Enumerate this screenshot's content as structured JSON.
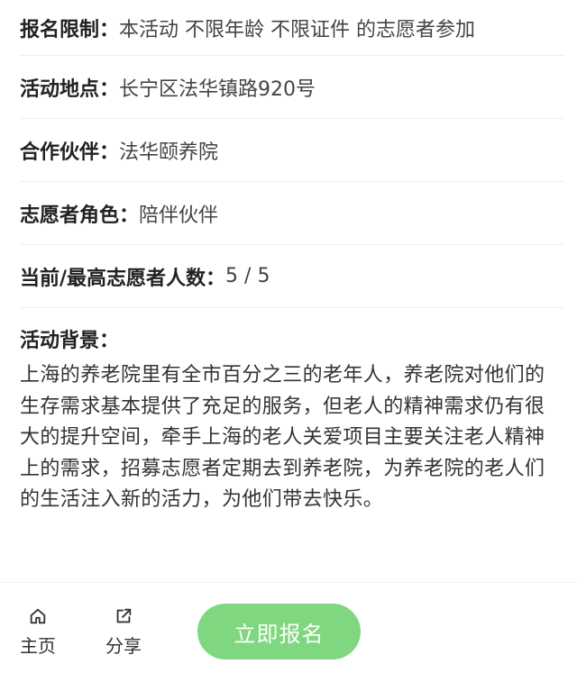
{
  "details": [
    {
      "label": "报名限制：",
      "value": "本活动 不限年龄 不限证件 的志愿者参加"
    },
    {
      "label": "活动地点：",
      "value": "长宁区法华镇路920号"
    },
    {
      "label": "合作伙伴：",
      "value": "法华颐养院"
    },
    {
      "label": "志愿者角色：",
      "value": "陪伴伙伴"
    },
    {
      "label": "当前/最高志愿者人数：",
      "value": "5 / 5"
    }
  ],
  "background": {
    "title": "活动背景：",
    "text": "上海的养老院里有全市百分之三的老年人，养老院对他们的生存需求基本提供了充足的服务，但老人的精神需求仍有很大的提升空间，牵手上海的老人关爱项目主要关注老人精神上的需求，招募志愿者定期去到养老院，为养老院的老人们的生活注入新的活力，为他们带去快乐。"
  },
  "tabbar": {
    "home_label": "主页",
    "home_icon": "home-icon",
    "share_label": "分享",
    "share_icon": "share-icon",
    "signup_label": "立即报名"
  },
  "colors": {
    "signup_button": "#7fd77f",
    "divider": "#eeeeee"
  }
}
